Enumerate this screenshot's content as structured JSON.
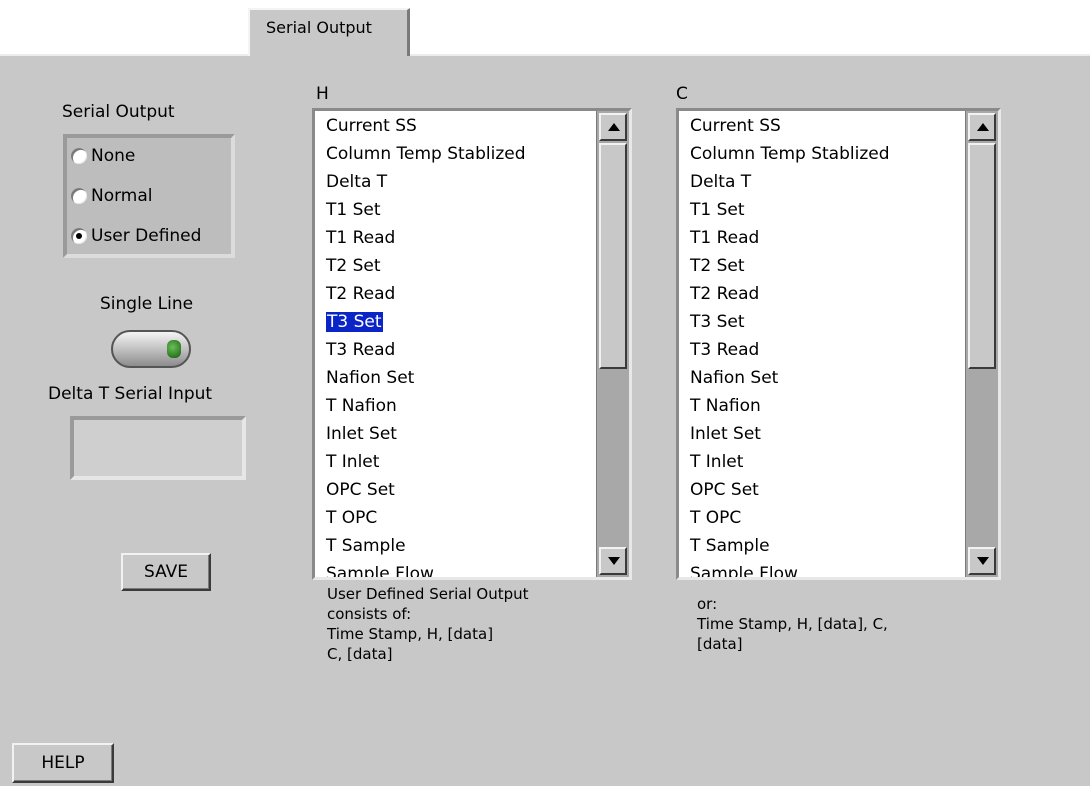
{
  "tab": {
    "label": "Serial Output"
  },
  "serial_output": {
    "label": "Serial Output",
    "options": [
      {
        "label": "None",
        "selected": false
      },
      {
        "label": "Normal",
        "selected": false
      },
      {
        "label": "User Defined",
        "selected": true
      }
    ]
  },
  "single_line": {
    "label": "Single Line",
    "value": true
  },
  "delta_t_input": {
    "label": "Delta T Serial Input",
    "value": ""
  },
  "save_label": "SAVE",
  "help_label": "HELP",
  "h_list": {
    "label": "H",
    "selected": "T3 Set",
    "items": [
      "Current SS",
      "Column Temp Stablized",
      "Delta T",
      "T1 Set",
      "T1 Read",
      "T2 Set",
      "T2 Read",
      "T3 Set",
      "T3 Read",
      "Nafion Set",
      "T Nafion",
      "Inlet Set",
      "T Inlet",
      "OPC Set",
      "T OPC",
      "T Sample",
      "Sample Flow"
    ]
  },
  "c_list": {
    "label": "C",
    "items": [
      "Current SS",
      "Column Temp Stablized",
      "Delta T",
      "T1 Set",
      "T1 Read",
      "T2 Set",
      "T2 Read",
      "T3 Set",
      "T3 Read",
      "Nafion Set",
      "T Nafion",
      "Inlet Set",
      "T Inlet",
      "OPC Set",
      "T OPC",
      "T Sample",
      "Sample Flow"
    ]
  },
  "notes": {
    "left": "User Defined Serial Output\nconsists of:\nTime Stamp, H, [data]\nC, [data]",
    "right": "or:\nTime Stamp, H, [data], C,\n[data]"
  },
  "colors": {
    "panel": "#c8c8c8",
    "selection": "#0a24c8"
  }
}
